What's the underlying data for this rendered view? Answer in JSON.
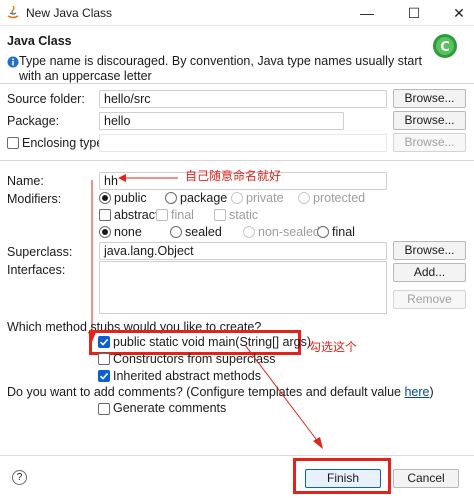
{
  "window": {
    "title": "New Java Class",
    "controls": {
      "minimize": "—",
      "maximize": "☐",
      "close": "✕"
    }
  },
  "header": {
    "title": "Java Class",
    "message": "Type name is discouraged. By convention, Java type names usually start with an uppercase letter",
    "message_icon": "info-icon"
  },
  "form": {
    "source_folder": {
      "label": "Source folder:",
      "value": "hello/src",
      "button": "Browse..."
    },
    "package": {
      "label": "Package:",
      "value": "hello",
      "button": "Browse..."
    },
    "enclosing_type": {
      "label": "Enclosing type:",
      "value": "",
      "button": "Browse...",
      "checked": false
    },
    "name": {
      "label": "Name:",
      "value": "hh"
    },
    "modifiers": {
      "label": "Modifiers:",
      "access": [
        "public",
        "package",
        "private",
        "protected"
      ],
      "access_selected": "public",
      "flags": [
        "abstract",
        "final",
        "static"
      ],
      "sealing": [
        "none",
        "sealed",
        "non-sealed",
        "final"
      ],
      "sealing_selected": "none"
    },
    "superclass": {
      "label": "Superclass:",
      "value": "java.lang.Object",
      "button": "Browse..."
    },
    "interfaces": {
      "label": "Interfaces:",
      "add_button": "Add...",
      "remove_button": "Remove"
    },
    "stubs": {
      "question": "Which method stubs would you like to create?",
      "items": [
        {
          "label": "public static void main(String[] args)",
          "checked": true
        },
        {
          "label": "Constructors from superclass",
          "checked": false
        },
        {
          "label": "Inherited abstract methods",
          "checked": true
        }
      ]
    },
    "comments": {
      "question": "Do you want to add comments? (Configure templates and default value ",
      "link": "here",
      "suffix": ")",
      "generate_label": "Generate comments",
      "checked": false
    }
  },
  "annotations": {
    "name_note": "自己随意命名就好",
    "stub_note": "勾选这个"
  },
  "footer": {
    "help": "?",
    "finish": "Finish",
    "cancel": "Cancel"
  },
  "colors": {
    "accent": "#0a5fd6",
    "annotation_red": "#e2231a",
    "link": "#0645ad"
  }
}
